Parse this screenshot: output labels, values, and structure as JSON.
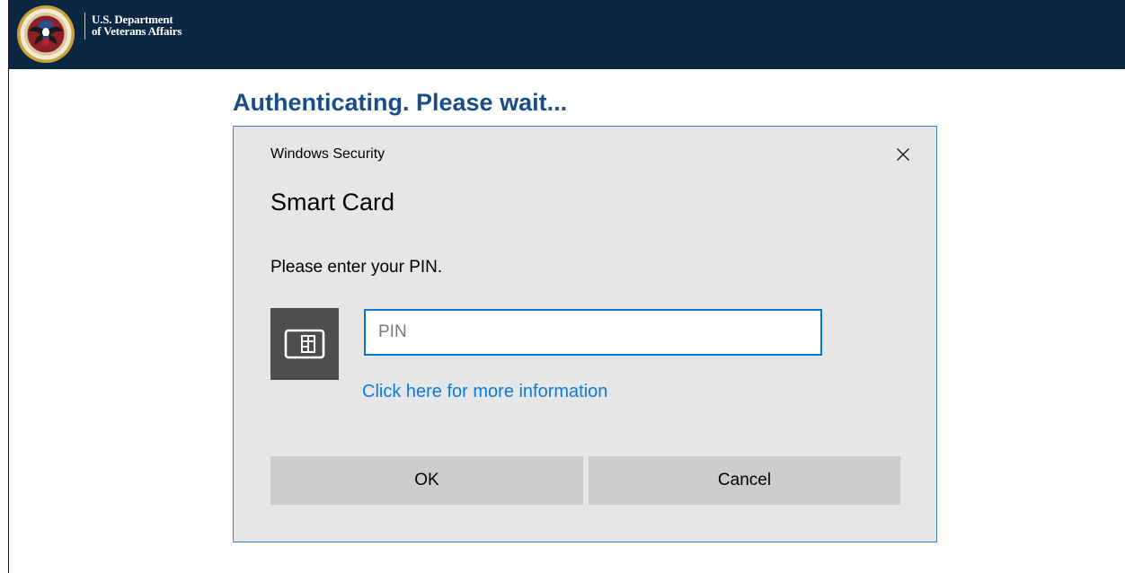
{
  "header": {
    "logo_icon": "va-seal-icon",
    "org_name_line1": "U.S. Department",
    "org_name_line2": "of Veterans Affairs",
    "background_color": "#0b2742"
  },
  "page": {
    "heading": "Authenticating. Please wait..."
  },
  "dialog": {
    "window_title": "Windows Security",
    "close_icon": "close-icon",
    "title": "Smart Card",
    "message": "Please enter your PIN.",
    "card_icon": "smart-card-icon",
    "pin_input": {
      "placeholder": "PIN",
      "value": ""
    },
    "more_info_link": "Click here for more information",
    "buttons": {
      "ok_label": "OK",
      "cancel_label": "Cancel"
    },
    "colors": {
      "accent": "#0078d7",
      "border": "#3d83c8",
      "background": "#e6e6e6",
      "link": "#0e7bd6",
      "button": "#cccccc"
    }
  }
}
